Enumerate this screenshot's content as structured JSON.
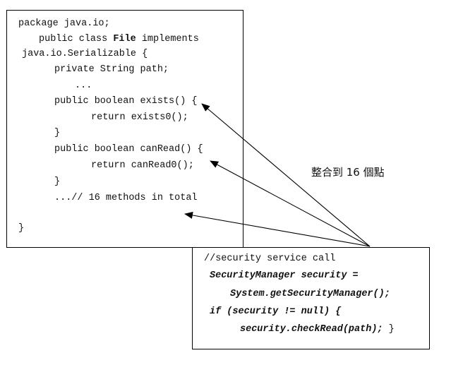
{
  "code_block": {
    "package_line": "package java.io;",
    "class_prefix": "public class ",
    "class_name": "File",
    "class_suffix": " implements",
    "implements_line": "java.io.Serializable {",
    "field_line": "private String path;",
    "ellipsis_line": "...",
    "exists_sig": "public boolean exists() {",
    "exists_body": "return exists0();",
    "close_brace_1": "}",
    "canread_sig": "public boolean canRead() {",
    "canread_body": "return canRead0();",
    "close_brace_2": "}",
    "methods_note": "...// 16 methods in total",
    "class_close": "}"
  },
  "security_block": {
    "comment": "//security service call",
    "line1": "SecurityManager security =",
    "line2": "System.getSecurityManager();",
    "line3": "if (security != null) {",
    "line4_code": "security.checkRead(path);",
    "line4_brace": " }"
  },
  "caption": "整合到 16 個點",
  "colors": {
    "stroke": "#000000",
    "text": "#111111"
  },
  "arrows": [
    {
      "from": "security-box",
      "to": "exists-signature"
    },
    {
      "from": "security-box",
      "to": "canread-body"
    },
    {
      "from": "security-box",
      "to": "methods-note"
    }
  ]
}
